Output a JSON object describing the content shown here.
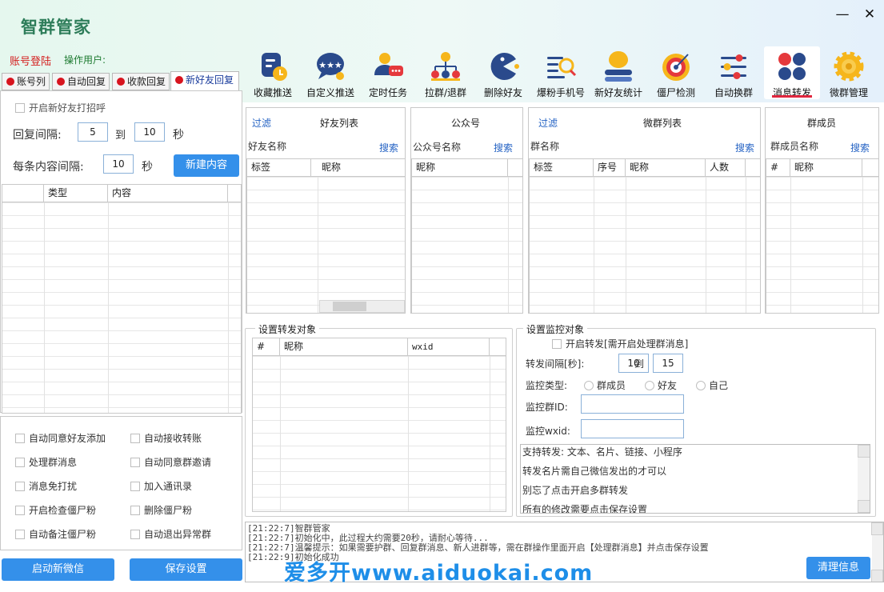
{
  "app": {
    "title": "智群管家",
    "minimize": "—",
    "close": "✕"
  },
  "account": {
    "label": "账号登陆",
    "operator_label": "操作用户:"
  },
  "toolbar": [
    {
      "label": "收藏推送",
      "icon": "bookmark-clock-icon"
    },
    {
      "label": "自定义推送",
      "icon": "star-bubble-icon"
    },
    {
      "label": "定时任务",
      "icon": "user-chat-icon"
    },
    {
      "label": "拉群/退群",
      "icon": "org-tree-icon"
    },
    {
      "label": "删除好友",
      "icon": "pacman-icon"
    },
    {
      "label": "爆粉手机号",
      "icon": "list-search-icon"
    },
    {
      "label": "新好友统计",
      "icon": "user-stats-icon"
    },
    {
      "label": "僵尸检测",
      "icon": "target-icon"
    },
    {
      "label": "自动换群",
      "icon": "sliders-icon"
    },
    {
      "label": "消息转发",
      "icon": "dots-grid-icon"
    },
    {
      "label": "微群管理",
      "icon": "gear-icon"
    }
  ],
  "left_tabs": [
    "账号列",
    "自动回复",
    "收款回复",
    "新好友回复"
  ],
  "new_friend": {
    "greet_label": "开启新好友打招呼",
    "reply_interval_label": "回复间隔:",
    "reply_from": "5",
    "to_label": "到",
    "reply_to": "10",
    "sec_label": "秒",
    "content_interval_label": "每条内容间隔:",
    "content_interval": "10",
    "content_sec_label": "秒",
    "new_content_button": "新建内容",
    "columns": [
      "类型",
      "内容"
    ]
  },
  "options": [
    [
      "自动同意好友添加",
      "自动接收转账"
    ],
    [
      "处理群消息",
      "自动同意群邀请"
    ],
    [
      "消息免打扰",
      "加入通讯录"
    ],
    [
      "开启检查僵尸粉",
      "删除僵尸粉"
    ],
    [
      "自动备注僵尸粉",
      "自动退出异常群"
    ]
  ],
  "bottom_buttons": {
    "start_wechat": "启动新微信",
    "save_settings": "保存设置"
  },
  "friends_panel": {
    "filter": "过滤",
    "title": "好友列表",
    "name_label": "好友名称",
    "search": "搜索",
    "columns": [
      "标签",
      "昵称"
    ]
  },
  "official_panel": {
    "title": "公众号",
    "name_label": "公众号名称",
    "search": "搜索",
    "columns": [
      "昵称"
    ]
  },
  "groups_panel": {
    "filter": "过滤",
    "title": "微群列表",
    "name_label": "群名称",
    "search": "搜索",
    "columns": [
      "标签",
      "序号",
      "昵称",
      "人数"
    ]
  },
  "members_panel": {
    "title": "群成员",
    "name_label": "群成员名称",
    "search": "搜索",
    "columns": [
      "#",
      "昵称"
    ]
  },
  "forward_target": {
    "title": "设置转发对象",
    "columns": [
      "#",
      "昵称",
      "wxid"
    ]
  },
  "monitor": {
    "title": "设置监控对象",
    "enable_label": "开启转发[需开启处理群消息]",
    "interval_label": "转发间隔[秒]:",
    "interval_from": "10",
    "to_label": "到",
    "interval_to": "15",
    "type_label": "监控类型:",
    "types": [
      "群成员",
      "好友",
      "自己"
    ],
    "group_id_label": "监控群ID:",
    "wxid_label": "监控wxid:",
    "notes": [
      "支持转发: 文本、名片、链接、小程序",
      "转发名片需自己微信发出的才可以",
      "别忘了点击开启多群转发",
      "所有的修改需要点击保存设置"
    ]
  },
  "log": {
    "lines": [
      "[21:22:7]智群管家",
      "[21:22:7]初始化中，此过程大约需要20秒，请耐心等待...",
      "[21:22:7]温馨提示：如果需要护群、回复群消息、新人进群等，需在群操作里面开启【处理群消息】并点击保存设置",
      "[21:22:9]初始化成功"
    ],
    "clear_button": "清理信息"
  },
  "watermark": "爱多开www.aiduokai.com",
  "colors": {
    "accent": "#3490ea",
    "title_green": "#2e7d5a",
    "tab_dot": "#d7141e",
    "active_underline": "#e0263e",
    "link": "#2563c4"
  }
}
